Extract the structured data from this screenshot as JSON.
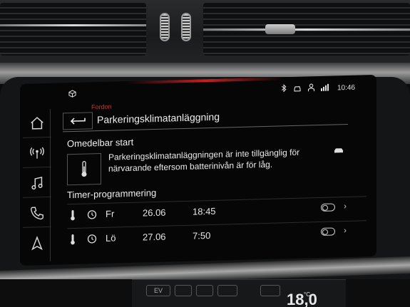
{
  "status_bar": {
    "time": "10:46",
    "icons": [
      "cube-icon",
      "bluetooth-icon",
      "car-icon",
      "person-icon",
      "signal-icon"
    ]
  },
  "header": {
    "breadcrumb": "Fordon",
    "title": "Parkeringsklimatanläggning",
    "back_icon": "back-arrow-icon"
  },
  "sidebar": {
    "items": [
      {
        "icon": "home-icon"
      },
      {
        "icon": "radio-icon"
      },
      {
        "icon": "music-icon"
      },
      {
        "icon": "phone-icon"
      },
      {
        "icon": "navigation-icon"
      }
    ]
  },
  "immediate_start": {
    "heading": "Omedelbar start",
    "message": "Parkeringsklimatanläggningen är inte tillgänglig för närvarande eftersom batterinivån är för låg."
  },
  "timers": {
    "heading": "Timer-programmering",
    "rows": [
      {
        "day": "Fr",
        "date": "26.06",
        "time": "18:45",
        "enabled": false
      },
      {
        "day": "Lö",
        "date": "27.06",
        "time": "7:50",
        "enabled": false
      }
    ]
  },
  "lower_climate": {
    "labels": [
      "EV"
    ],
    "temperature": "18,0",
    "unit": "°C"
  },
  "colors": {
    "accent_red": "#c8312b",
    "text": "#e6e6e6",
    "background": "#060606"
  }
}
